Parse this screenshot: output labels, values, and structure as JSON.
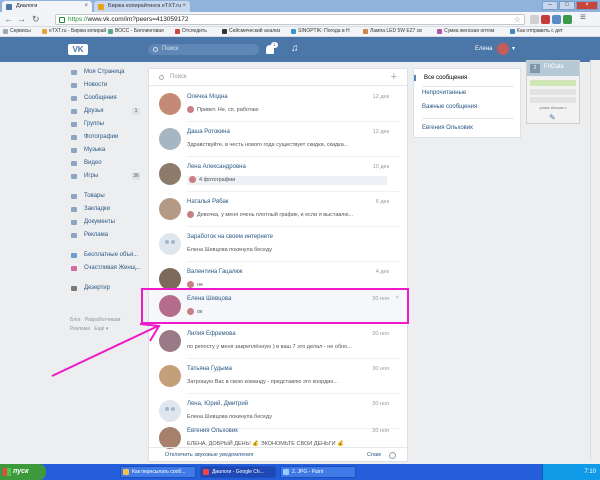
{
  "browser": {
    "tabs": [
      {
        "label": "Диалоги"
      },
      {
        "label": "Биржа копирайтинга eTXT.ru"
      }
    ],
    "url_protocol": "https://",
    "url_rest": "www.vk.com/im?peers=413059172",
    "bookmarks": [
      "Сервисы",
      "eTXT.ru - Биржа копирай",
      "ВОСС - Биллинговая",
      "Отследить",
      "Сейсмический анализ",
      "SINOPTIK: Погода в Н",
      "Лампа LED 5W E27 св",
      "Сумка женская оптом",
      "Как отправить с дет"
    ]
  },
  "vk": {
    "logo": "VK",
    "search_placeholder": "Поиск",
    "notif_count": "1",
    "user_name": "Елена",
    "menu": [
      {
        "label": "Моя Страница",
        "icon": "home-icon"
      },
      {
        "label": "Новости",
        "icon": "news-icon"
      },
      {
        "label": "Сообщения",
        "icon": "messages-icon"
      },
      {
        "label": "Друзья",
        "icon": "friends-icon",
        "count": "1"
      },
      {
        "label": "Группы",
        "icon": "groups-icon"
      },
      {
        "label": "Фотографии",
        "icon": "photos-icon"
      },
      {
        "label": "Музыка",
        "icon": "music-icon"
      },
      {
        "label": "Видео",
        "icon": "video-icon"
      },
      {
        "label": "Игры",
        "icon": "games-icon",
        "count": "36"
      },
      {
        "label": "Товары",
        "icon": "goods-icon"
      },
      {
        "label": "Закладки",
        "icon": "bookmarks-icon"
      },
      {
        "label": "Документы",
        "icon": "documents-icon"
      },
      {
        "label": "Реклама",
        "icon": "ads-icon"
      },
      {
        "label": "Бесплатные объя...",
        "icon": "app-icon"
      },
      {
        "label": "Счастливая Женщ...",
        "icon": "app-icon"
      },
      {
        "label": "Дезертир",
        "icon": "app-icon"
      }
    ],
    "footer_links": [
      "Блог",
      "Разработчикам",
      "Реклама",
      "Ещё"
    ],
    "dialog_search_placeholder": "Поиск",
    "dialogs": [
      {
        "name": "Олечка Модна",
        "date": "12 дек",
        "preview": "Привет. Не, сп, работаю",
        "mini": true
      },
      {
        "name": "Даша Ротокина",
        "date": "12 дек",
        "preview": "Здравствуйте, в честь нового года существует скидки, скидка...",
        "mini": false
      },
      {
        "name": "Лена Александровна",
        "date": "10 дек",
        "preview": "4 фотографии",
        "mini": true,
        "unread": true
      },
      {
        "name": "Наталья Рябак",
        "date": "6 дек",
        "preview": "Девочка, у меня очень плотный график, и если я выставлю...",
        "mini": true
      },
      {
        "name": "Заработок на своем интернете",
        "date": "",
        "preview": "Елена Шевцова покинула беседу",
        "mini": false,
        "group": true
      },
      {
        "name": "Валентина Гацалюк",
        "date": "4 дек",
        "preview": "не",
        "mini": true
      },
      {
        "name": "Елена Шевцова",
        "date": "30 ноя",
        "preview": "ок",
        "mini": true,
        "highlighted": true
      },
      {
        "name": "Лилия Ефремова",
        "date": "30 ноя",
        "preview": "по репосту у меня закреплённую ) в ваш 7 это делал - не обно...",
        "mini": false
      },
      {
        "name": "Татьяна Гудыма",
        "date": "30 ноя",
        "preview": "Затрошую Вас в свою команду - представлю это координ...",
        "mini": false
      },
      {
        "name": "Лена, Юрий, Дмитрий",
        "date": "30 ноя",
        "preview": "Елена Шевцова покинула беседу",
        "mini": false,
        "group": true
      },
      {
        "name": "Евгения Ольховик",
        "date": "30 ноя",
        "preview": "ЕЛЕНА, ДОБРЫЙ ДЕНЬ! 💰 ЭКОНОМЬТЕ СВОИ ДЕНЬГИ 💰",
        "mini": false
      }
    ],
    "footer_mute": "Отключить звуковые уведомления",
    "footer_spam": "Спам",
    "filters": [
      "Все сообщения",
      "Непрочитанные",
      "Важные сообщения",
      "Евгения Ольховик"
    ]
  },
  "extension": {
    "badge": "2",
    "name": "FriGate",
    "note": "узнать больше о"
  },
  "colors": {
    "vk_blue": "#4a76a8",
    "highlight": "#ec1aca",
    "taskbar": "#245edb"
  },
  "taskbar": {
    "start": "пуск",
    "items": [
      "Как пересылать сооб...",
      "Диалоги - Google Ch...",
      "2. JPG - Paint"
    ],
    "clock": "7:10"
  }
}
